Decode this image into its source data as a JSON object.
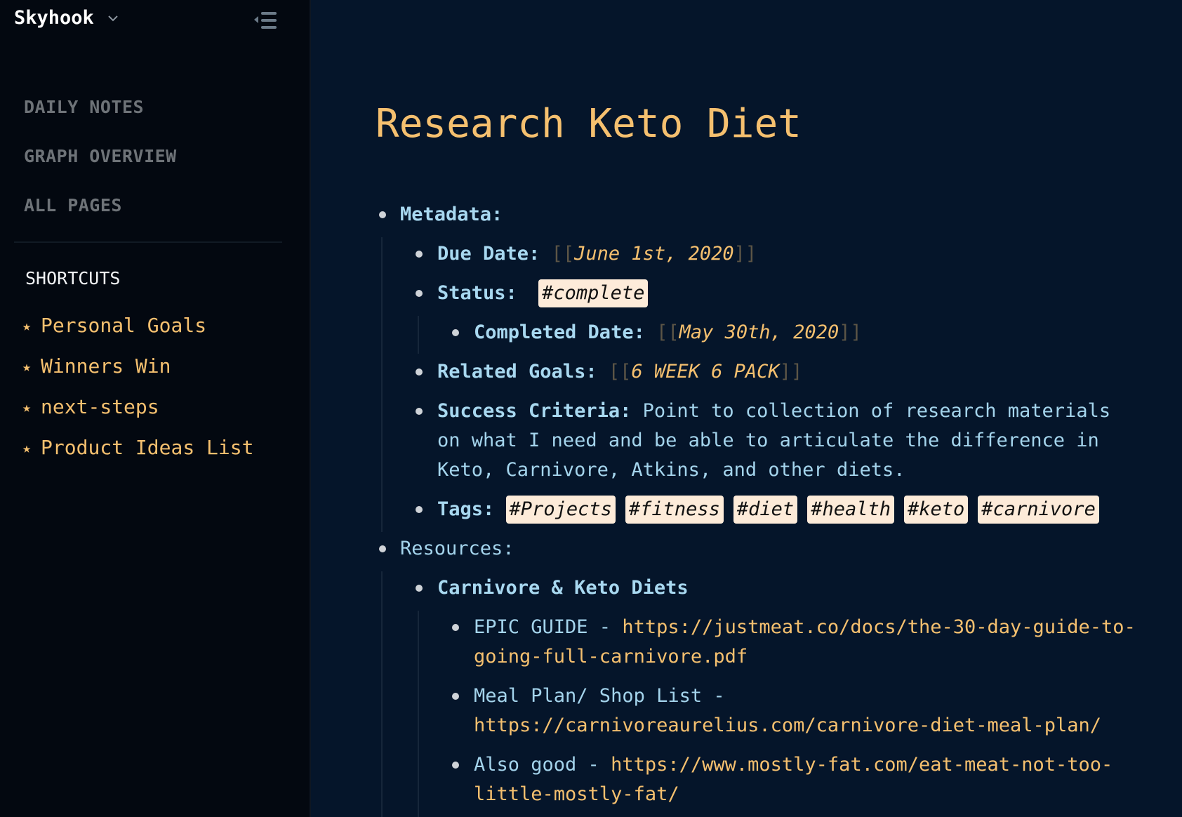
{
  "sidebar": {
    "workspace_name": "Skyhook",
    "nav": [
      {
        "label": "DAILY NOTES"
      },
      {
        "label": "GRAPH OVERVIEW"
      },
      {
        "label": "ALL PAGES"
      }
    ],
    "shortcuts_title": "SHORTCUTS",
    "star_glyph": "★",
    "shortcuts": [
      {
        "label": "Personal Goals"
      },
      {
        "label": "Winners Win"
      },
      {
        "label": "next-steps"
      },
      {
        "label": "Product Ideas List"
      }
    ]
  },
  "page": {
    "title": "Research Keto Diet",
    "open_brackets": "[[",
    "close_brackets": "]]",
    "metadata": {
      "label": "Metadata:",
      "due_date": {
        "label": "Due Date:",
        "value": "June 1st, 2020"
      },
      "status": {
        "label": "Status:",
        "tag": "#complete"
      },
      "completed_date": {
        "label": "Completed Date:",
        "value": "May 30th, 2020"
      },
      "related_goals": {
        "label": "Related Goals:",
        "value": "6 WEEK 6 PACK"
      },
      "success_criteria": {
        "label": "Success Criteria:",
        "lines": [
          "Point to collection of research materials",
          "on what I need and be able to articulate the difference in",
          "Keto, Carnivore, Atkins, and other diets."
        ]
      },
      "tags": {
        "label": "Tags:",
        "items": [
          "#Projects",
          "#fitness",
          "#diet",
          "#health",
          "#keto",
          "#carnivore"
        ]
      }
    },
    "resources": {
      "label": "Resources:",
      "group": {
        "label": "Carnivore & Keto Diets",
        "items": [
          {
            "text": "EPIC GUIDE - ",
            "url_line1": "https://justmeat.co/docs/the-30-day-guide-to-",
            "url_line2": "going-full-carnivore.pdf"
          },
          {
            "text": "Meal Plan/ Shop List -",
            "url_line1": "",
            "url_line2": "https://carnivoreaurelius.com/carnivore-diet-meal-plan/"
          },
          {
            "text": "Also good - ",
            "url_line1": "https://www.mostly-fat.com/eat-meat-not-too-",
            "url_line2": "little-mostly-fat/"
          }
        ]
      }
    }
  }
}
